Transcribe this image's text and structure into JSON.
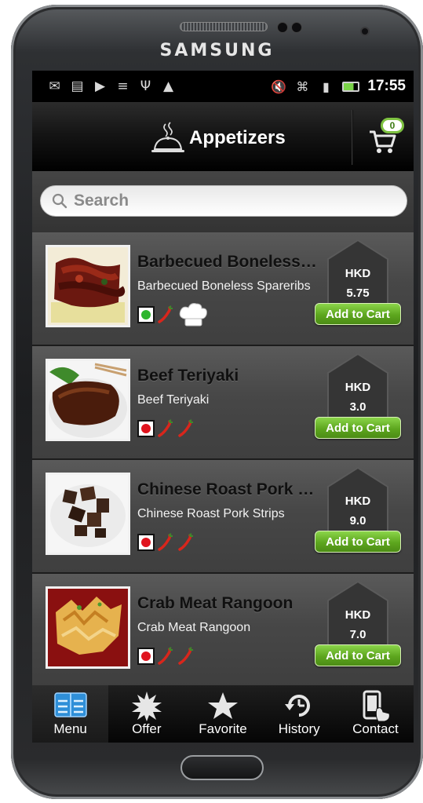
{
  "device": {
    "brand": "SAMSUNG"
  },
  "status_bar": {
    "time": "17:55"
  },
  "header": {
    "title": "Appetizers",
    "cart_count": "0"
  },
  "search": {
    "placeholder": "Search"
  },
  "items": [
    {
      "name": "Barbecued Boneless Spareribs",
      "desc": "Barbecued Boneless Spareribs",
      "currency": "HKD",
      "price": "5.75",
      "add_label": "Add to Cart",
      "veg": false,
      "chili_count": 1,
      "chef_special": true
    },
    {
      "name": "Beef Teriyaki",
      "desc": "Beef Teriyaki",
      "currency": "HKD",
      "price": "3.0",
      "add_label": "Add to Cart",
      "veg": false,
      "chili_count": 2,
      "chef_special": false
    },
    {
      "name": "Chinese Roast Pork Strips",
      "desc": "Chinese Roast Pork Strips",
      "currency": "HKD",
      "price": "9.0",
      "add_label": "Add to Cart",
      "veg": false,
      "chili_count": 2,
      "chef_special": false
    },
    {
      "name": "Crab Meat Rangoon",
      "desc": "Crab Meat Rangoon",
      "currency": "HKD",
      "price": "7.0",
      "add_label": "Add to Cart",
      "veg": false,
      "chili_count": 2,
      "chef_special": false
    }
  ],
  "tabs": [
    {
      "label": "Menu",
      "icon": "menu-grid-icon",
      "active": true
    },
    {
      "label": "Offer",
      "icon": "starburst-icon",
      "active": false
    },
    {
      "label": "Favorite",
      "icon": "star-icon",
      "active": false
    },
    {
      "label": "History",
      "icon": "clock-history-icon",
      "active": false
    },
    {
      "label": "Contact",
      "icon": "phone-touch-icon",
      "active": false
    }
  ],
  "colors": {
    "accent_green": "#5da61e",
    "veg_green": "#2db52d",
    "nonveg_red": "#e0141e",
    "chili_red": "#d8261c",
    "tab_blue": "#3fa7e8"
  }
}
